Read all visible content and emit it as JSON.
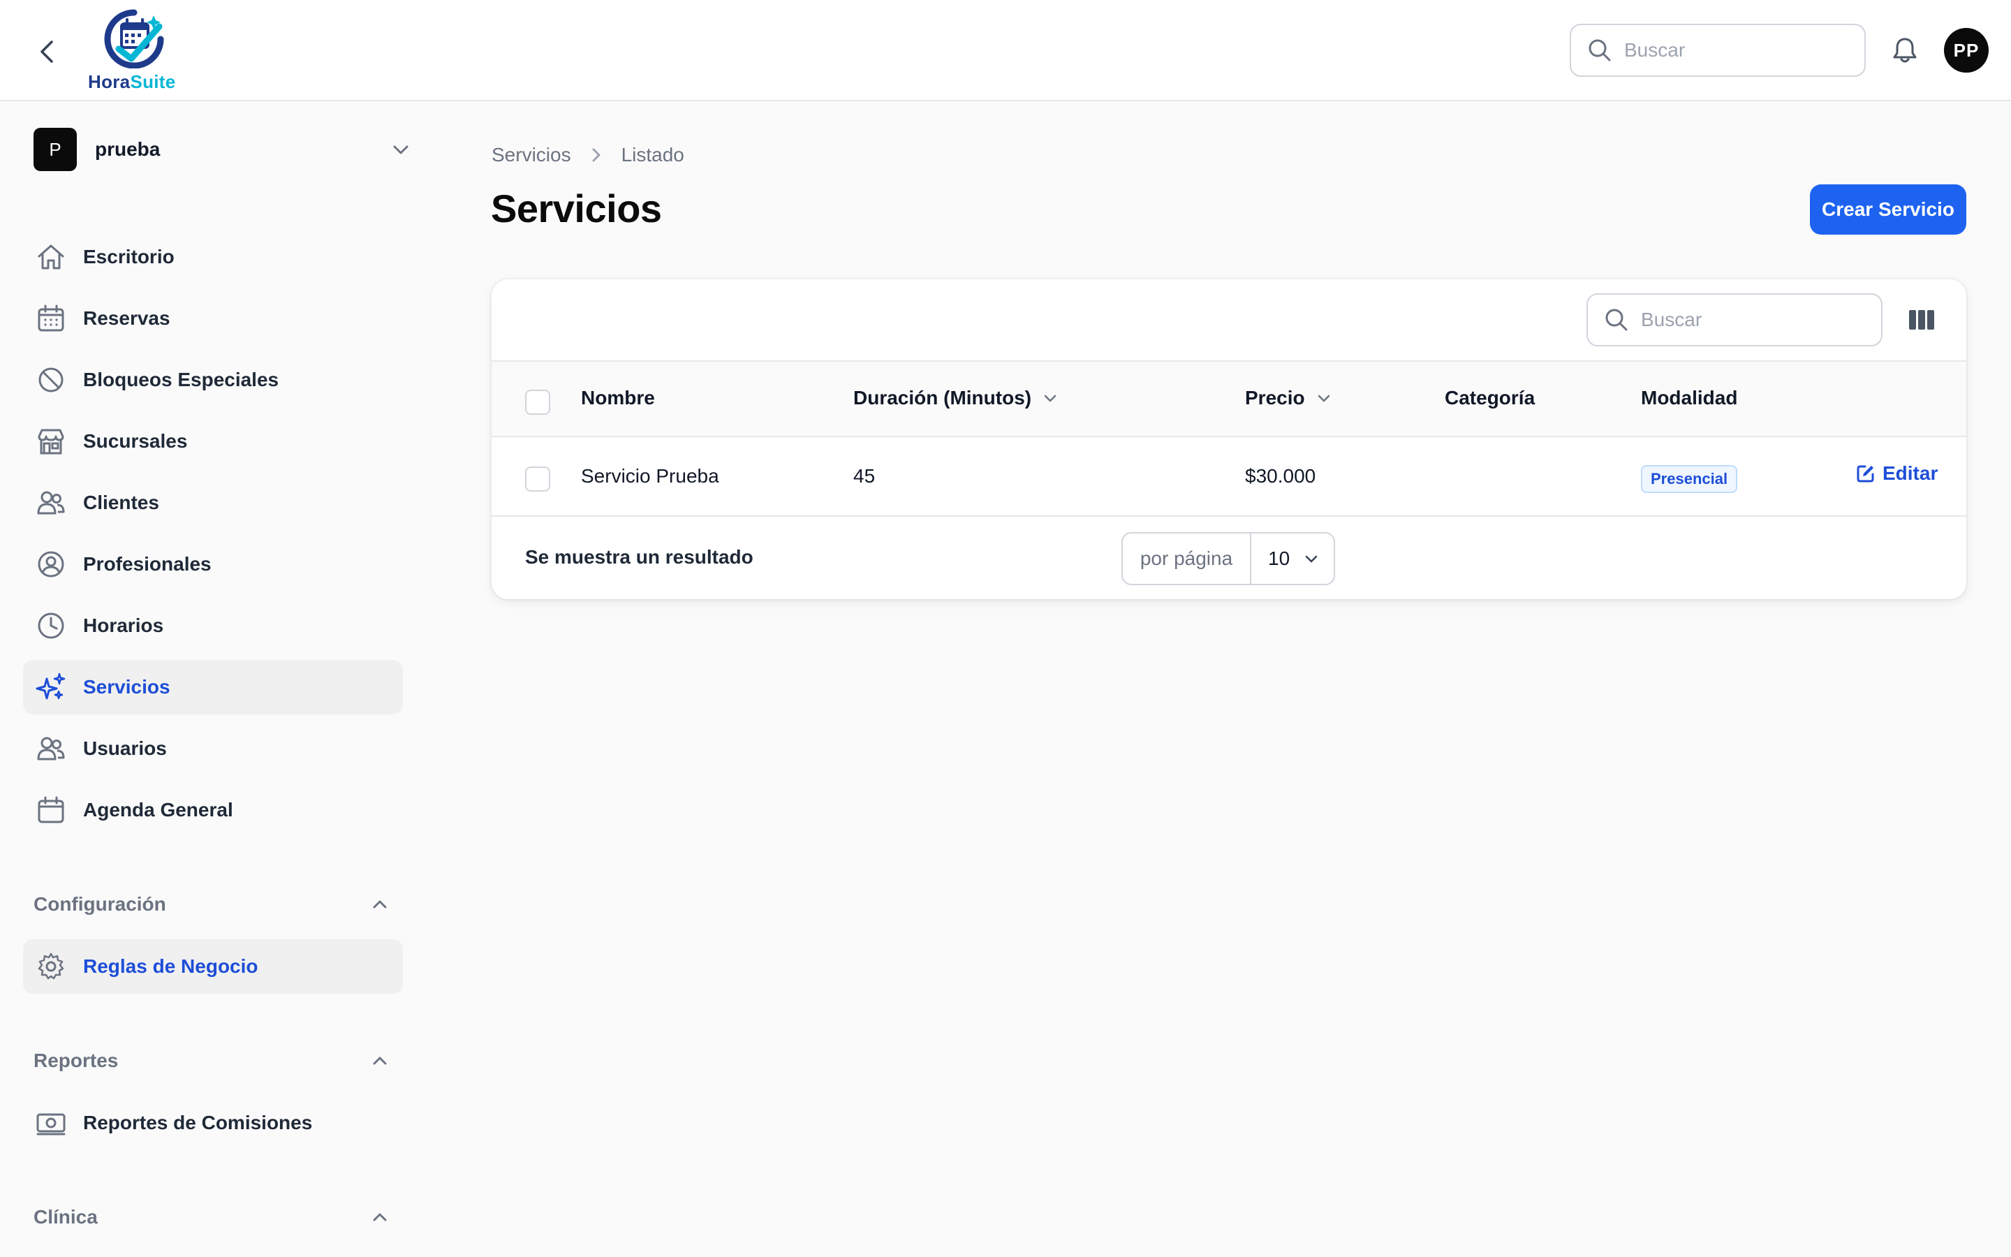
{
  "app": {
    "logo_text_a": "Hora",
    "logo_text_b": "Suite",
    "brand_color": "#1d63f0"
  },
  "topbar": {
    "search_placeholder": "Buscar",
    "avatar_initials": "PP"
  },
  "sidebar": {
    "tenant_initial": "P",
    "tenant_name": "prueba",
    "items": [
      {
        "label": "Escritorio",
        "icon": "home-icon"
      },
      {
        "label": "Reservas",
        "icon": "calendar-grid-icon"
      },
      {
        "label": "Bloqueos Especiales",
        "icon": "no-entry-icon"
      },
      {
        "label": "Sucursales",
        "icon": "storefront-icon"
      },
      {
        "label": "Clientes",
        "icon": "users-icon"
      },
      {
        "label": "Profesionales",
        "icon": "user-circle-icon"
      },
      {
        "label": "Horarios",
        "icon": "clock-icon"
      },
      {
        "label": "Servicios",
        "icon": "sparkles-icon",
        "active": true
      },
      {
        "label": "Usuarios",
        "icon": "users-icon"
      },
      {
        "label": "Agenda General",
        "icon": "calendar-icon"
      }
    ],
    "groups": [
      {
        "label": "Configuración",
        "items": [
          {
            "label": "Reglas de Negocio",
            "icon": "cog-icon"
          }
        ]
      },
      {
        "label": "Reportes",
        "items": [
          {
            "label": "Reportes de Comisiones",
            "icon": "cash-icon"
          }
        ]
      },
      {
        "label": "Clínica",
        "items": []
      }
    ]
  },
  "main": {
    "breadcrumb": [
      "Servicios",
      "Listado"
    ],
    "title": "Servicios",
    "create_button": "Crear Servicio"
  },
  "table": {
    "search_placeholder": "Buscar",
    "columns": [
      "Nombre",
      "Duración (Minutos)",
      "Precio",
      "Categoría",
      "Modalidad"
    ],
    "rows": [
      {
        "nombre": "Servicio Prueba",
        "duracion": "45",
        "precio": "$30.000",
        "categoria": "",
        "modalidad": "Presencial",
        "action": "Editar"
      }
    ],
    "footer_text": "Se muestra un resultado",
    "per_page_label": "por página",
    "per_page_value": "10"
  }
}
